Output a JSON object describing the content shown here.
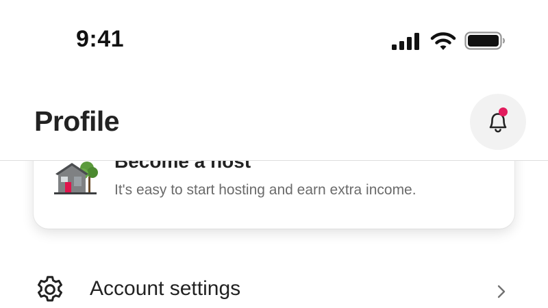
{
  "status_bar": {
    "time": "9:41",
    "icons": [
      "cellular-signal-icon",
      "wifi-icon",
      "battery-icon"
    ]
  },
  "header": {
    "title": "Profile",
    "notification_icon": "bell-icon",
    "has_unread_notification": true
  },
  "host_card": {
    "title": "Become a host",
    "subtitle": "It's easy to start hosting and earn extra income.",
    "illustration": "house-illustration"
  },
  "menu": {
    "items": [
      {
        "icon": "gear-icon",
        "label": "Account settings",
        "trailing_icon": "chevron-right-icon"
      }
    ]
  },
  "colors": {
    "text_primary": "#222222",
    "text_secondary": "#6a6a6a",
    "notification_dot": "#e21c5d",
    "bell_button_bg": "#f2f2f2",
    "divider": "#dddddd"
  }
}
